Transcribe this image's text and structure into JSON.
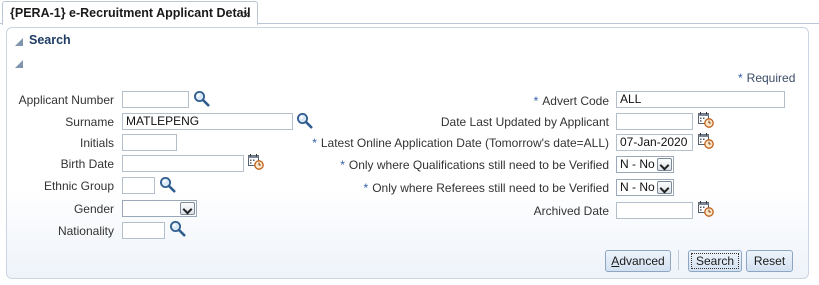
{
  "tab": {
    "title": "{PERA-1} e-Recruitment Applicant Detail",
    "close_glyph": "×"
  },
  "search": {
    "title": "Search",
    "required_star": "*",
    "required_label": "Required"
  },
  "left_fields": {
    "applicant_number": {
      "label": "Applicant Number",
      "value": ""
    },
    "surname": {
      "label": "Surname",
      "value": "MATLEPENG"
    },
    "initials": {
      "label": "Initials",
      "value": ""
    },
    "birth_date": {
      "label": "Birth Date",
      "value": ""
    },
    "ethnic_group": {
      "label": "Ethnic Group",
      "value": ""
    },
    "gender": {
      "label": "Gender",
      "value": ""
    },
    "nationality": {
      "label": "Nationality",
      "value": ""
    }
  },
  "right_fields": {
    "advert_code": {
      "star": "*",
      "label": "Advert Code",
      "value": "ALL"
    },
    "date_last_updated": {
      "label": "Date Last Updated by Applicant",
      "value": ""
    },
    "latest_online_date": {
      "star": "*",
      "label": "Latest Online Application Date (Tomorrow's date=ALL)",
      "value": "07-Jan-2020"
    },
    "qualifications_verify": {
      "star": "*",
      "label": "Only where Qualifications still need to be Verified",
      "value": "N - No"
    },
    "referees_verify": {
      "star": "*",
      "label": "Only where Referees still need to be Verified",
      "value": "N - No"
    },
    "archived_date": {
      "label": "Archived Date",
      "value": ""
    }
  },
  "buttons": {
    "advanced_accesskey": "A",
    "advanced_rest": "dvanced",
    "search": "Search",
    "reset": "Reset"
  },
  "icons": {
    "lookup": "magnifier-icon",
    "calendar": "calendar-clock-icon",
    "disclose": "disclosure-triangle-icon"
  },
  "colors": {
    "accent": "#1f3c63",
    "required_star": "#2f5fa8",
    "button_border": "#8fa6c2",
    "panel_border": "#c9d5e2"
  }
}
